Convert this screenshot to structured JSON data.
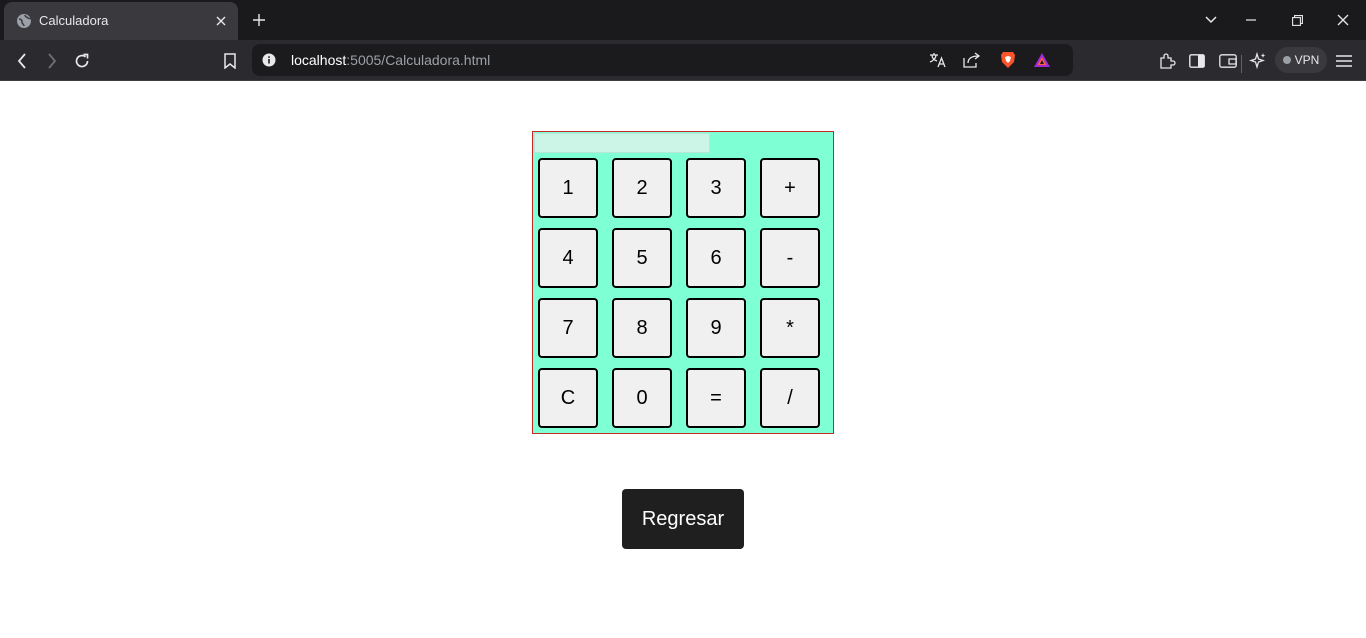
{
  "browser": {
    "tab_title": "Calculadora",
    "url_host": "localhost",
    "url_rest": ":5005/Calculadora.html",
    "vpn_label": "VPN"
  },
  "calculator": {
    "display_value": "",
    "keys": [
      "1",
      "2",
      "3",
      "+",
      "4",
      "5",
      "6",
      "-",
      "7",
      "8",
      "9",
      "*",
      "C",
      "0",
      "=",
      "/"
    ]
  },
  "page": {
    "back_button_label": "Regresar"
  },
  "colors": {
    "calculator_bg": "#7fffd4",
    "calculator_border": "#c62828",
    "key_bg": "#f0f0f0",
    "back_button_bg": "#1f1f1f"
  }
}
